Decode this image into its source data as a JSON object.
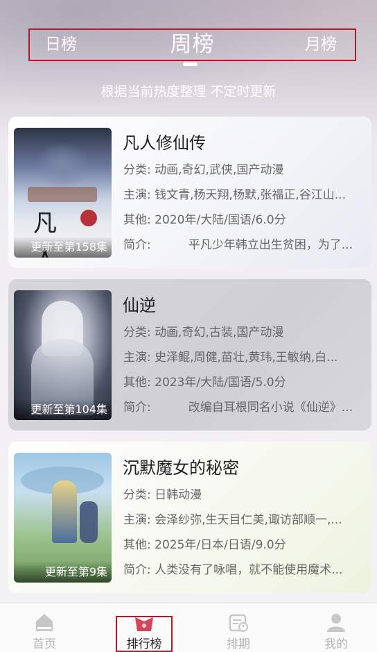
{
  "tabs": {
    "left": "日榜",
    "center": "周榜",
    "right": "月榜"
  },
  "subtitle": "根据当前热度整理 不定时更新",
  "items": [
    {
      "title": "凡人修仙传",
      "badge": "更新至第158集",
      "genre_label": "分类:",
      "genre": "动画,奇幻,武侠,国产动漫",
      "cast_label": "主演:",
      "cast": "钱文青,杨天翔,杨默,张福正,谷江山...",
      "other_label": "其他:",
      "other": "2020年/大陆/国语/6.0分",
      "intro_label": "简介:",
      "intro": "平凡少年韩立出生贫困，为了..."
    },
    {
      "title": "仙逆",
      "badge": "更新至第104集",
      "genre_label": "分类:",
      "genre": "动画,奇幻,古装,国产动漫",
      "cast_label": "主演:",
      "cast": "史泽鲲,周健,苗壮,黄玮,王敏纳,白...",
      "other_label": "其他:",
      "other": "2023年/大陆/国语/5.0分",
      "intro_label": "简介:",
      "intro": "改编自耳根同名小说《仙逆》..."
    },
    {
      "title": "沉默魔女的秘密",
      "badge": "更新至第9集",
      "genre_label": "分类:",
      "genre": "日韩动漫",
      "cast_label": "主演:",
      "cast": "会泽纱弥,生天目仁美,诹访部顺一,...",
      "other_label": "其他:",
      "other": "2025年/日本/日语/9.0分",
      "intro_label": "简介:",
      "intro": "人类没有了咏唱，就不能使用魔术..."
    }
  ],
  "nav": [
    {
      "label": "首页",
      "icon": "home-icon"
    },
    {
      "label": "排行榜",
      "icon": "ranking-icon"
    },
    {
      "label": "排期",
      "icon": "schedule-icon"
    },
    {
      "label": "我的",
      "icon": "profile-icon"
    }
  ]
}
